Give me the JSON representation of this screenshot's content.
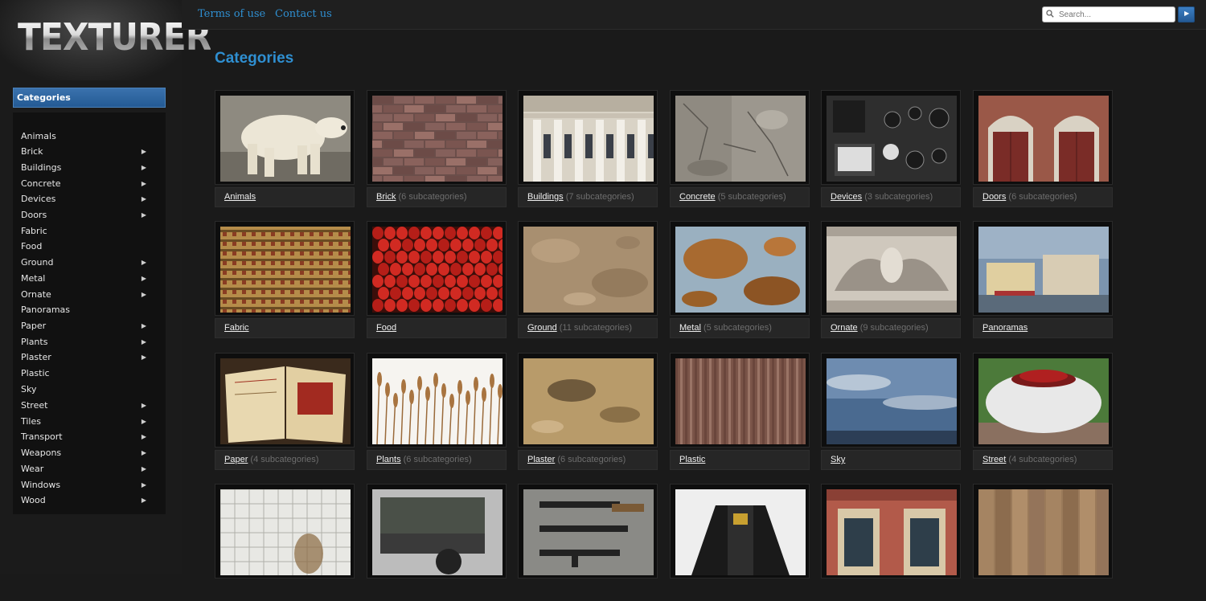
{
  "logo": {
    "text": "TEXTURER"
  },
  "topnav": {
    "links": [
      "Terms of use",
      "Contact us"
    ]
  },
  "search": {
    "placeholder": "Search..."
  },
  "sidebar": {
    "header": "Categories",
    "items": [
      {
        "label": "Animals",
        "has_sub": false
      },
      {
        "label": "Brick",
        "has_sub": true
      },
      {
        "label": "Buildings",
        "has_sub": true
      },
      {
        "label": "Concrete",
        "has_sub": true
      },
      {
        "label": "Devices",
        "has_sub": true
      },
      {
        "label": "Doors",
        "has_sub": true
      },
      {
        "label": "Fabric",
        "has_sub": false
      },
      {
        "label": "Food",
        "has_sub": false
      },
      {
        "label": "Ground",
        "has_sub": true
      },
      {
        "label": "Metal",
        "has_sub": true
      },
      {
        "label": "Ornate",
        "has_sub": true
      },
      {
        "label": "Panoramas",
        "has_sub": false
      },
      {
        "label": "Paper",
        "has_sub": true
      },
      {
        "label": "Plants",
        "has_sub": true
      },
      {
        "label": "Plaster",
        "has_sub": true
      },
      {
        "label": "Plastic",
        "has_sub": false
      },
      {
        "label": "Sky",
        "has_sub": false
      },
      {
        "label": "Street",
        "has_sub": true
      },
      {
        "label": "Tiles",
        "has_sub": true
      },
      {
        "label": "Transport",
        "has_sub": true
      },
      {
        "label": "Weapons",
        "has_sub": true
      },
      {
        "label": "Wear",
        "has_sub": true
      },
      {
        "label": "Windows",
        "has_sub": true
      },
      {
        "label": "Wood",
        "has_sub": true
      }
    ]
  },
  "main": {
    "title": "Categories",
    "categories": [
      {
        "name": "Animals",
        "sub": "",
        "image": "polar bear"
      },
      {
        "name": "Brick",
        "sub": "(6 subcategories)",
        "image": "brick wall"
      },
      {
        "name": "Buildings",
        "sub": "(7 subcategories)",
        "image": "building facade with columns"
      },
      {
        "name": "Concrete",
        "sub": "(5 subcategories)",
        "image": "cracked concrete wall"
      },
      {
        "name": "Devices",
        "sub": "(3 subcategories)",
        "image": "control panel with gauges"
      },
      {
        "name": "Doors",
        "sub": "(6 subcategories)",
        "image": "red arched doors"
      },
      {
        "name": "Fabric",
        "sub": "",
        "image": "patterned carpet fabric"
      },
      {
        "name": "Food",
        "sub": "",
        "image": "strawberries"
      },
      {
        "name": "Ground",
        "sub": "(11 subcategories)",
        "image": "sandy ground"
      },
      {
        "name": "Metal",
        "sub": "(5 subcategories)",
        "image": "rusty metal"
      },
      {
        "name": "Ornate",
        "sub": "(9 subcategories)",
        "image": "ornate stone relief"
      },
      {
        "name": "Panoramas",
        "sub": "",
        "image": "city panorama"
      },
      {
        "name": "Paper",
        "sub": "(4 subcategories)",
        "image": "old open book"
      },
      {
        "name": "Plants",
        "sub": "(6 subcategories)",
        "image": "dry reeds"
      },
      {
        "name": "Plaster",
        "sub": "(6 subcategories)",
        "image": "worn plaster wall"
      },
      {
        "name": "Plastic",
        "sub": "",
        "image": "corrugated plastic"
      },
      {
        "name": "Sky",
        "sub": "",
        "image": "cloudy sky"
      },
      {
        "name": "Street",
        "sub": "(4 subcategories)",
        "image": "stone flower planter"
      },
      {
        "name": "",
        "sub": "",
        "image": "dirty white tiles"
      },
      {
        "name": "",
        "sub": "",
        "image": "old truck"
      },
      {
        "name": "",
        "sub": "",
        "image": "guns"
      },
      {
        "name": "",
        "sub": "",
        "image": "leather jacket"
      },
      {
        "name": "",
        "sub": "",
        "image": "building windows"
      },
      {
        "name": "",
        "sub": "",
        "image": "wooden planks"
      }
    ]
  },
  "colors": {
    "accent": "#2f8fd1",
    "header_blue": "#245a94",
    "background": "#1a1a1a"
  }
}
